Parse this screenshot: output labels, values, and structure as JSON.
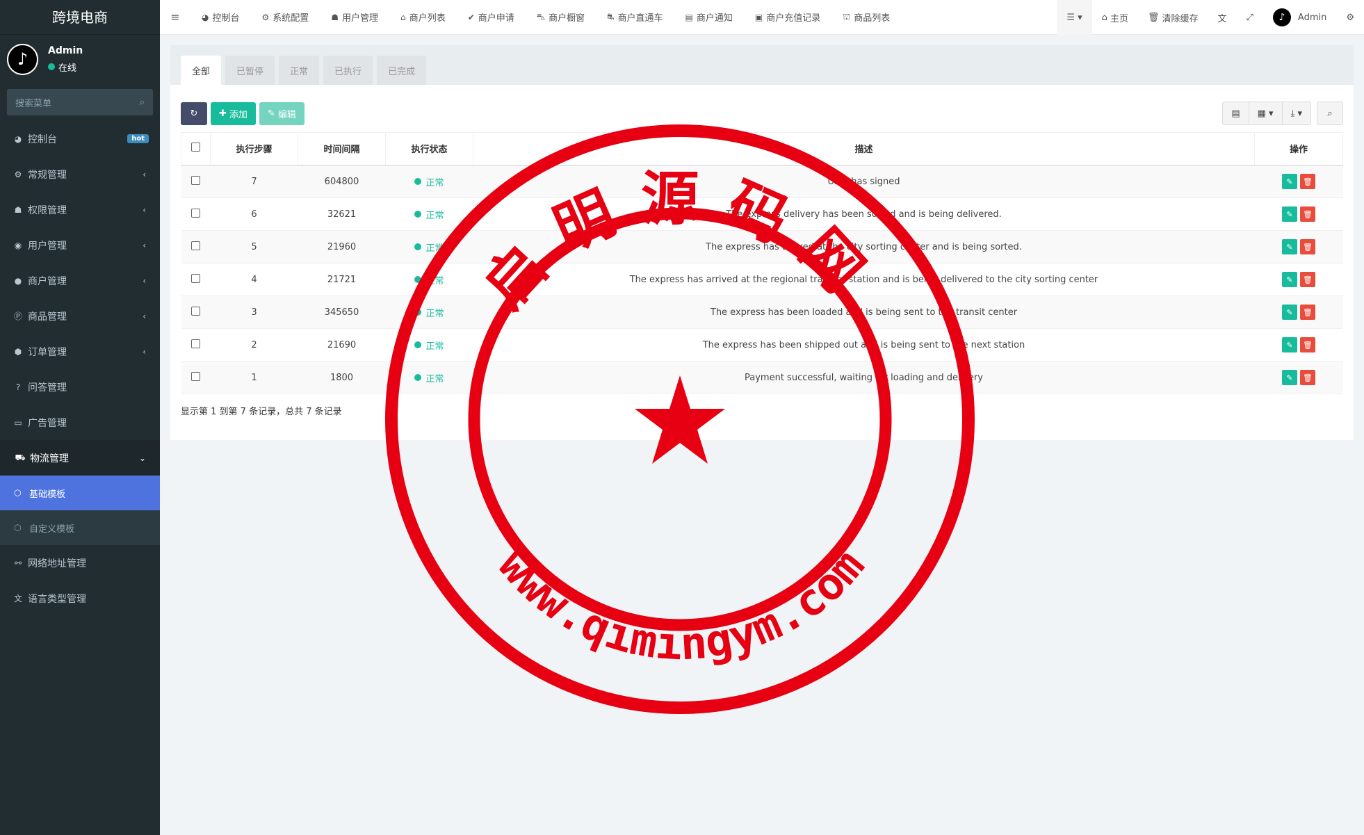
{
  "app": {
    "title": "跨境电商"
  },
  "user": {
    "name": "Admin",
    "status": "在线"
  },
  "sidebar": {
    "search_placeholder": "搜索菜单",
    "hot_badge": "hot",
    "items": [
      {
        "label": "控制台",
        "icon": "dashboard-icon"
      },
      {
        "label": "常规管理",
        "icon": "cogs-icon"
      },
      {
        "label": "权限管理",
        "icon": "users-icon"
      },
      {
        "label": "用户管理",
        "icon": "user-circle-icon"
      },
      {
        "label": "商户管理",
        "icon": "apple-icon"
      },
      {
        "label": "商品管理",
        "icon": "product-hunt-icon"
      },
      {
        "label": "订单管理",
        "icon": "cube-icon"
      },
      {
        "label": "问答管理",
        "icon": "question-circle-icon"
      },
      {
        "label": "广告管理",
        "icon": "ad-icon"
      },
      {
        "label": "物流管理",
        "icon": "truck-icon"
      }
    ],
    "sub_items": [
      {
        "label": "基础模板",
        "icon": "cube-icon"
      },
      {
        "label": "自定义模板",
        "icon": "cubes-icon"
      }
    ],
    "after_items": [
      {
        "label": "网络地址管理",
        "icon": "link-icon"
      },
      {
        "label": "语言类型管理",
        "icon": "language-icon"
      }
    ]
  },
  "topnav": {
    "tabs": [
      "控制台",
      "系统配置",
      "用户管理",
      "商户列表",
      "商户申请",
      "商户橱窗",
      "商户直通车",
      "商户通知",
      "商户充值记录",
      "商品列表"
    ],
    "home": "主页",
    "clear_cache": "清除缓存",
    "admin": "Admin"
  },
  "content": {
    "tabs": [
      "全部",
      "已暂停",
      "正常",
      "已执行",
      "已完成"
    ],
    "add_label": "添加",
    "edit_label": "编辑",
    "columns": [
      "执行步骤",
      "时间间隔",
      "执行状态",
      "描述",
      "操作"
    ],
    "rows": [
      {
        "step": "7",
        "interval": "604800",
        "status": "正常",
        "desc": "User has signed"
      },
      {
        "step": "6",
        "interval": "32621",
        "status": "正常",
        "desc": "The express delivery has been sorted and is being delivered."
      },
      {
        "step": "5",
        "interval": "21960",
        "status": "正常",
        "desc": "The express has arrived at the city sorting center and is being sorted."
      },
      {
        "step": "4",
        "interval": "21721",
        "status": "正常",
        "desc": "The express has arrived at the regional transfer station and is being delivered to the city sorting center"
      },
      {
        "step": "3",
        "interval": "345650",
        "status": "正常",
        "desc": "The express has been loaded and is being sent to the transit center"
      },
      {
        "step": "2",
        "interval": "21690",
        "status": "正常",
        "desc": "The express has been shipped out and is being sent to the next station"
      },
      {
        "step": "1",
        "interval": "1800",
        "status": "正常",
        "desc": "Payment successful, waiting for loading and delivery"
      }
    ],
    "pager": "显示第 1 到第 7 条记录，总共 7 条记录"
  },
  "watermark": {
    "chars": [
      "启",
      "明",
      "源",
      "码",
      "网"
    ],
    "url": "www.qimingym.com",
    "color": "#e60012"
  }
}
